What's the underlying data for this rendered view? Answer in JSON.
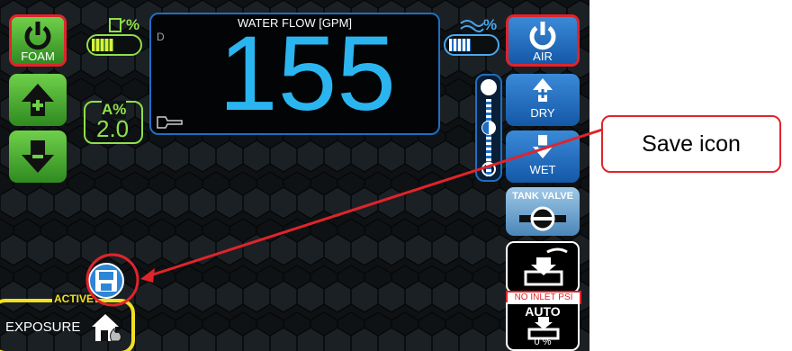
{
  "foam_button": {
    "label": "FOAM"
  },
  "air_button": {
    "label": "AIR"
  },
  "water_flow": {
    "title": "WATER FLOW [GPM]",
    "value": "155",
    "mode_letter": "D"
  },
  "foam_level": {
    "percent_label": "%"
  },
  "air_level": {
    "percent_label": "%"
  },
  "a_percent": {
    "label": "A%",
    "value": "2.0"
  },
  "dry_button": {
    "label": "DRY"
  },
  "wet_button": {
    "label": "WET"
  },
  "tank_valve": {
    "label": "TANK VALVE"
  },
  "inlet_status": {
    "label": "NO INLET PSI"
  },
  "auto_button": {
    "label": "AUTO",
    "value": "0 %"
  },
  "status": {
    "active_label": "ACTIVE",
    "exposure_label": "EXPOSURE"
  },
  "callout": {
    "text": "Save icon"
  },
  "colors": {
    "accent_green": "#5cc23a",
    "accent_blue": "#1e6fc4",
    "flow_cyan": "#2bb5f0",
    "highlight_red": "#e0242b",
    "active_yellow": "#f0e020"
  },
  "icons": [
    "power-icon",
    "arrow-up-icon",
    "arrow-down-icon",
    "save-icon",
    "house-fire-icon",
    "valve-icon",
    "hand-press-icon"
  ]
}
